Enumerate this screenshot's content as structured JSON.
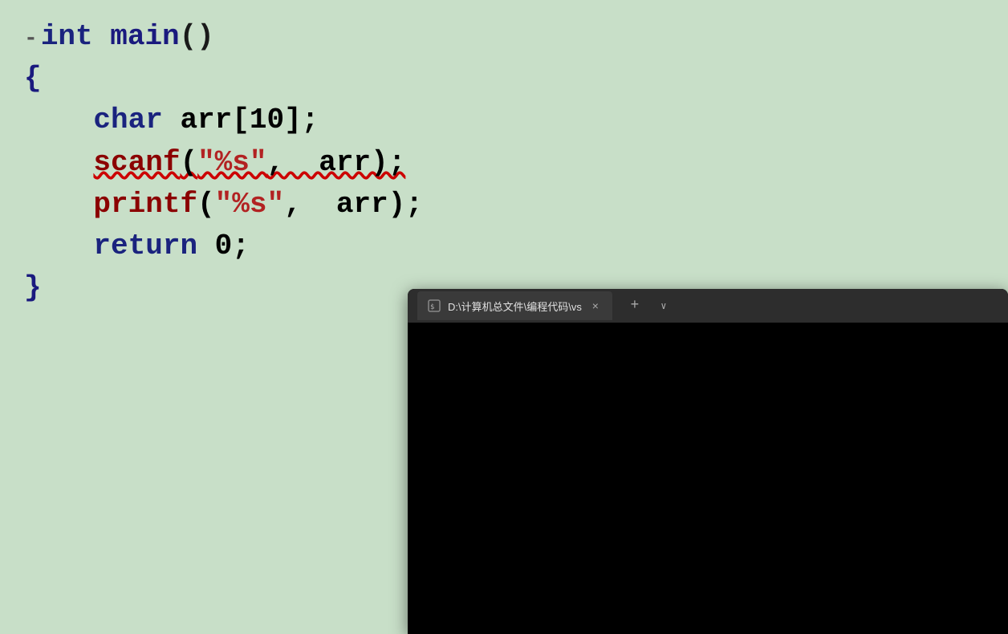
{
  "editor": {
    "background": "#c8dfc8",
    "lines": [
      {
        "id": "line-int-main",
        "indicator": "-",
        "tokens": [
          {
            "text": "int",
            "class": "kw-int"
          },
          {
            "text": " ",
            "class": ""
          },
          {
            "text": "main",
            "class": "fn-main"
          },
          {
            "text": "()",
            "class": "punctuation"
          }
        ]
      },
      {
        "id": "line-open-brace",
        "indicator": "",
        "tokens": [
          {
            "text": "{",
            "class": "brace"
          }
        ]
      },
      {
        "id": "line-char-arr",
        "indicator": "",
        "tokens": [
          {
            "text": "    char",
            "class": "kw-char"
          },
          {
            "text": " arr[10];",
            "class": "punctuation"
          }
        ]
      },
      {
        "id": "line-scanf",
        "indicator": "",
        "squiggly": true,
        "tokens": [
          {
            "text": "    ",
            "class": ""
          },
          {
            "text": "scanf",
            "class": "fn-scanf"
          },
          {
            "text": "(",
            "class": "punctuation"
          },
          {
            "text": "\"%s\"",
            "class": "str-literal"
          },
          {
            "text": ",  arr);",
            "class": "punctuation"
          }
        ]
      },
      {
        "id": "line-printf",
        "indicator": "",
        "tokens": [
          {
            "text": "    ",
            "class": ""
          },
          {
            "text": "printf",
            "class": "fn-printf"
          },
          {
            "text": "(",
            "class": "punctuation"
          },
          {
            "text": "\"%s\"",
            "class": "str-literal"
          },
          {
            "text": ",  arr);",
            "class": "punctuation"
          }
        ]
      },
      {
        "id": "line-return",
        "indicator": "",
        "tokens": [
          {
            "text": "    ",
            "class": ""
          },
          {
            "text": "return",
            "class": "kw-return"
          },
          {
            "text": " 0;",
            "class": "punctuation"
          }
        ]
      },
      {
        "id": "line-close-brace",
        "indicator": "",
        "tokens": [
          {
            "text": "}",
            "class": "brace"
          }
        ]
      }
    ]
  },
  "terminal": {
    "tab_title": "D:\\计算机总文件\\编程代码\\vs",
    "tab_icon": "⬛",
    "close_label": "×",
    "new_tab_label": "+",
    "dropdown_label": "∨"
  }
}
